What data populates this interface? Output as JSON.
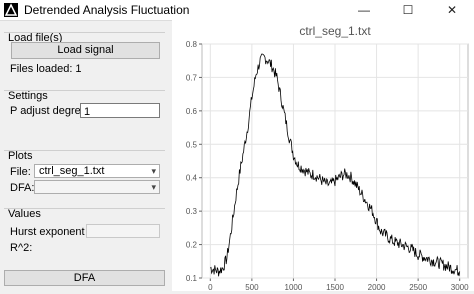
{
  "window": {
    "title": "Detrended Analysis Fluctuation",
    "minimize_glyph": "—",
    "maximize_glyph": "☐",
    "close_glyph": "✕"
  },
  "load_group": {
    "title": "Load file(s)",
    "button_label": "Load signal",
    "status": "Files loaded: 1",
    "status_color": "#1a33c9"
  },
  "settings_group": {
    "title": "Settings",
    "p_label": "P adjust degree:",
    "p_value": "1"
  },
  "plots_group": {
    "title": "Plots",
    "file_label": "File:",
    "file_value": "ctrl_seg_1.txt",
    "dfa_label": "DFA:",
    "dfa_value": ""
  },
  "values_group": {
    "title": "Values",
    "hurst_label": "Hurst exponent h:",
    "hurst_value": "",
    "r2_label": "R^2:"
  },
  "dfa_button": {
    "label": "DFA"
  },
  "chart_data": {
    "type": "line",
    "title": "ctrl_seg_1.txt",
    "xlabel": "",
    "ylabel": "",
    "xlim": [
      -100,
      3100
    ],
    "ylim": [
      0.1,
      0.8
    ],
    "x_ticks": [
      "0",
      "500",
      "1000",
      "1500",
      "2000",
      "2500",
      "3000"
    ],
    "y_ticks": [
      "0.1",
      "0.2",
      "0.3",
      "0.4",
      "0.5",
      "0.6",
      "0.7",
      "0.8"
    ],
    "grid": true,
    "line_color": "#000000",
    "series": [
      {
        "x": [
          0,
          100,
          150,
          200,
          250,
          300,
          350,
          400,
          450,
          500,
          550,
          600,
          650,
          700,
          750,
          800,
          850,
          900,
          950,
          1000,
          1050,
          1100,
          1150,
          1200,
          1250,
          1300,
          1350,
          1400,
          1450,
          1500,
          1550,
          1600,
          1650,
          1700,
          1750,
          1800,
          1850,
          1900,
          1950,
          2000,
          2050,
          2100,
          2150,
          2200,
          2300,
          2400,
          2500,
          2600,
          2700,
          2800,
          2900,
          3000
        ],
        "values": [
          0.13,
          0.12,
          0.13,
          0.16,
          0.24,
          0.33,
          0.41,
          0.48,
          0.55,
          0.64,
          0.71,
          0.75,
          0.76,
          0.75,
          0.73,
          0.7,
          0.64,
          0.58,
          0.52,
          0.47,
          0.44,
          0.43,
          0.42,
          0.41,
          0.41,
          0.4,
          0.39,
          0.38,
          0.38,
          0.39,
          0.4,
          0.41,
          0.41,
          0.4,
          0.38,
          0.36,
          0.34,
          0.32,
          0.3,
          0.27,
          0.24,
          0.23,
          0.22,
          0.21,
          0.2,
          0.19,
          0.17,
          0.16,
          0.15,
          0.14,
          0.13,
          0.12
        ]
      }
    ]
  }
}
